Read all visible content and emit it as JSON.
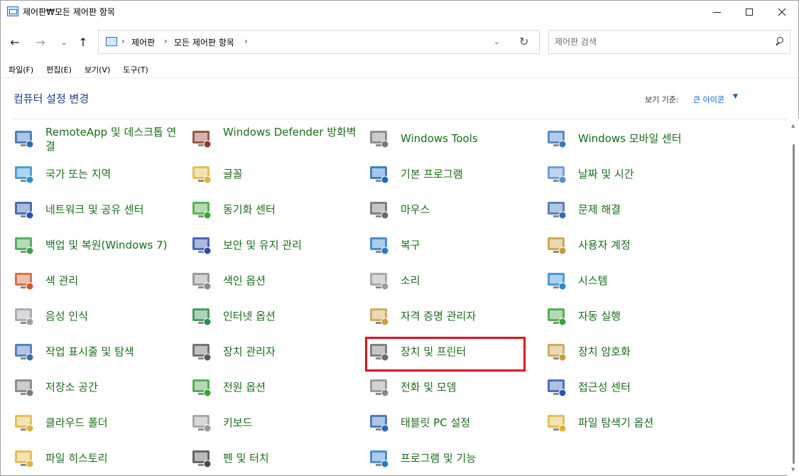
{
  "window": {
    "title": "제어판₩모든 제어판 항목",
    "minimize_icon": "minimize-icon",
    "maximize_icon": "maximize-icon",
    "close_icon": "close-icon"
  },
  "nav": {
    "back": "←",
    "forward": "→",
    "recent": "⌄",
    "up": "↑"
  },
  "address": {
    "sep1": "›",
    "crumb1": "제어판",
    "sep2": "›",
    "crumb2": "모든 제어판 항목",
    "sep3": "›",
    "dropdown": "⌄",
    "refresh": "↻"
  },
  "search": {
    "placeholder": "제어판 검색"
  },
  "menu": [
    "파일(F)",
    "편집(E)",
    "보기(V)",
    "도구(T)"
  ],
  "content": {
    "heading": "컴퓨터 설정 변경",
    "view_by_label": "보기 기준:",
    "view_by_value": "큰 아이콘",
    "view_by_caret": "▼"
  },
  "items": [
    {
      "label": "RemoteApp 및 데스크톱 연결",
      "icon": "remoteapp-icon",
      "color": "#2b6cb0",
      "two": true
    },
    {
      "label": "Windows Defender 방화벽",
      "icon": "firewall-icon",
      "color": "#8b3a2a",
      "two": true
    },
    {
      "label": "Windows Tools",
      "icon": "windows-tools-icon",
      "color": "#7a7a7a",
      "two": false
    },
    {
      "label": "Windows 모바일 센터",
      "icon": "mobility-center-icon",
      "color": "#3a78c0",
      "two": false
    },
    {
      "label": "국가 또는 지역",
      "icon": "region-icon",
      "color": "#2f8fd0",
      "two": false
    },
    {
      "label": "글꼴",
      "icon": "fonts-icon",
      "color": "#e0b43a",
      "two": false
    },
    {
      "label": "기본 프로그램",
      "icon": "default-programs-icon",
      "color": "#1b6fc4",
      "two": false
    },
    {
      "label": "날짜 및 시간",
      "icon": "date-time-icon",
      "color": "#5a8fd0",
      "two": false
    },
    {
      "label": "네트워크 및 공유 센터",
      "icon": "network-icon",
      "color": "#2354a8",
      "two": false
    },
    {
      "label": "동기화 센터",
      "icon": "sync-center-icon",
      "color": "#3aa63a",
      "two": false
    },
    {
      "label": "마우스",
      "icon": "mouse-icon",
      "color": "#6a6a6a",
      "two": false
    },
    {
      "label": "문제 해결",
      "icon": "troubleshooting-icon",
      "color": "#3a6cb0",
      "two": false
    },
    {
      "label": "백업 및 복원(Windows 7)",
      "icon": "backup-icon",
      "color": "#3aa04a",
      "two": false
    },
    {
      "label": "보안 및 유지 관리",
      "icon": "security-flag-icon",
      "color": "#2a4aa8",
      "two": false
    },
    {
      "label": "복구",
      "icon": "recovery-icon",
      "color": "#2a7ac8",
      "two": false
    },
    {
      "label": "사용자 계정",
      "icon": "user-accounts-icon",
      "color": "#c89a3a",
      "two": false
    },
    {
      "label": "색 관리",
      "icon": "color-management-icon",
      "color": "#d05a2a",
      "two": false
    },
    {
      "label": "색인 옵션",
      "icon": "indexing-icon",
      "color": "#8a8a8a",
      "two": false
    },
    {
      "label": "소리",
      "icon": "sound-icon",
      "color": "#9a9a9a",
      "two": false
    },
    {
      "label": "시스템",
      "icon": "system-icon",
      "color": "#2a8ad0",
      "two": false
    },
    {
      "label": "음성 인식",
      "icon": "speech-icon",
      "color": "#9aa0a6",
      "two": false
    },
    {
      "label": "인터넷 옵션",
      "icon": "internet-options-icon",
      "color": "#2a8a4a",
      "two": false
    },
    {
      "label": "자격 증명 관리자",
      "icon": "credential-manager-icon",
      "color": "#c8a040",
      "two": false
    },
    {
      "label": "자동 실행",
      "icon": "autoplay-icon",
      "color": "#3aa03a",
      "two": false
    },
    {
      "label": "작업 표시줄 및 탐색",
      "icon": "taskbar-icon",
      "color": "#3a6cb0",
      "two": false
    },
    {
      "label": "장치 관리자",
      "icon": "device-manager-icon",
      "color": "#5a5a5a",
      "two": false
    },
    {
      "label": "장치 및 프린터",
      "icon": "devices-printers-icon",
      "color": "#6a6a6a",
      "two": false
    },
    {
      "label": "장치 암호화",
      "icon": "device-encryption-icon",
      "color": "#c8a040",
      "two": false
    },
    {
      "label": "저장소 공간",
      "icon": "storage-spaces-icon",
      "color": "#7a7a7a",
      "two": false
    },
    {
      "label": "전원 옵션",
      "icon": "power-options-icon",
      "color": "#3aa03a",
      "two": false
    },
    {
      "label": "전화 및 모뎀",
      "icon": "phone-modem-icon",
      "color": "#8a8a8a",
      "two": false
    },
    {
      "label": "접근성 센터",
      "icon": "ease-of-access-icon",
      "color": "#2a5ab0",
      "two": false
    },
    {
      "label": "클라우드 폴더",
      "icon": "work-folders-icon",
      "color": "#e0b43a",
      "two": false
    },
    {
      "label": "키보드",
      "icon": "keyboard-icon",
      "color": "#9a9a9a",
      "two": false
    },
    {
      "label": "태블릿 PC 설정",
      "icon": "tablet-pc-icon",
      "color": "#2a6ab0",
      "two": false
    },
    {
      "label": "파일 탐색기 옵션",
      "icon": "file-explorer-options-icon",
      "color": "#e0b43a",
      "two": false
    },
    {
      "label": "파일 히스토리",
      "icon": "file-history-icon",
      "color": "#e0b43a",
      "two": false
    },
    {
      "label": "펜 및 터치",
      "icon": "pen-touch-icon",
      "color": "#4a4a4a",
      "two": false
    },
    {
      "label": "프로그램 및 기능",
      "icon": "programs-features-icon",
      "color": "#2a7ac8",
      "two": false
    }
  ],
  "highlight_color": "#e0121e"
}
